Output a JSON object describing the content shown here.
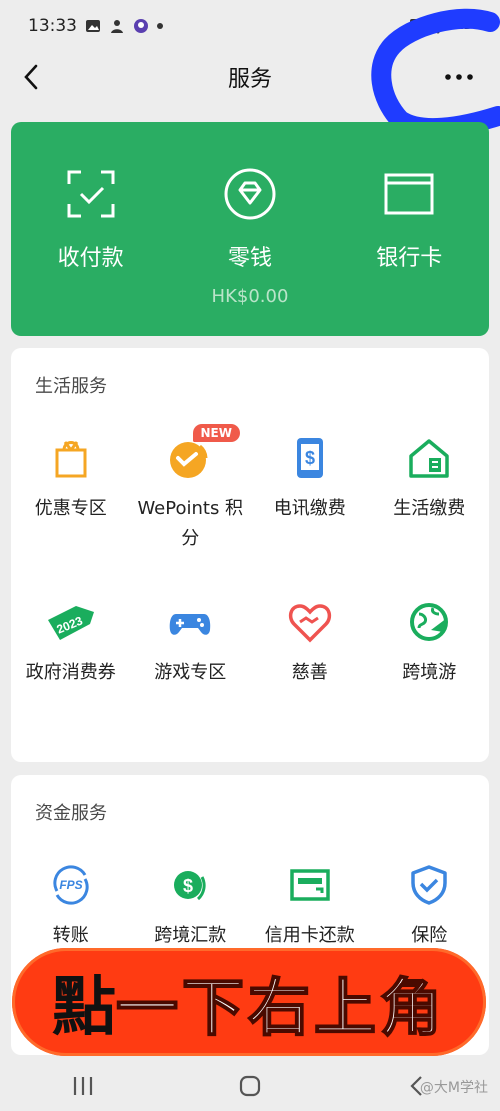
{
  "status_bar": {
    "time": "13:33",
    "network": "HD"
  },
  "nav": {
    "title": "服务",
    "back_icon": "chevron-left-icon",
    "more_icon": "more-horizontal-icon"
  },
  "wallet": {
    "items": [
      {
        "label": "收付款",
        "icon": "scan-pay-icon"
      },
      {
        "label": "零钱",
        "icon": "diamond-wallet-icon",
        "sub": "HK$0.00"
      },
      {
        "label": "银行卡",
        "icon": "bank-card-icon"
      }
    ],
    "bg_color": "#2aad63"
  },
  "life_services": {
    "title": "生活服务",
    "rows": [
      [
        {
          "label": "优惠专区",
          "icon": "gift-bag-icon"
        },
        {
          "label": "WePoints 积分",
          "icon": "wepoints-icon",
          "badge": "NEW"
        },
        {
          "label": "电讯缴费",
          "icon": "phone-bill-icon"
        },
        {
          "label": "生活缴费",
          "icon": "home-bill-icon"
        }
      ],
      [
        {
          "label": "政府消费券",
          "icon": "voucher-2023-icon"
        },
        {
          "label": "游戏专区",
          "icon": "gamepad-icon"
        },
        {
          "label": "慈善",
          "icon": "charity-heart-icon"
        },
        {
          "label": "跨境游",
          "icon": "globe-plane-icon"
        }
      ]
    ]
  },
  "fund_services": {
    "title": "资金服务",
    "items": [
      {
        "label": "转账",
        "icon": "fps-icon"
      },
      {
        "label": "跨境汇款",
        "icon": "remittance-icon"
      },
      {
        "label": "信用卡还款",
        "icon": "credit-card-repay-icon"
      },
      {
        "label": "保险",
        "icon": "insurance-shield-icon"
      }
    ]
  },
  "cta_banner": {
    "first_char": "點",
    "rest": "一下右上角"
  },
  "watermark": "@大M学社",
  "colors": {
    "accent_green": "#2aad63",
    "banner_red": "#ff3b12",
    "annotation_blue": "#1f3cff",
    "badge_red": "#f05a4a"
  }
}
